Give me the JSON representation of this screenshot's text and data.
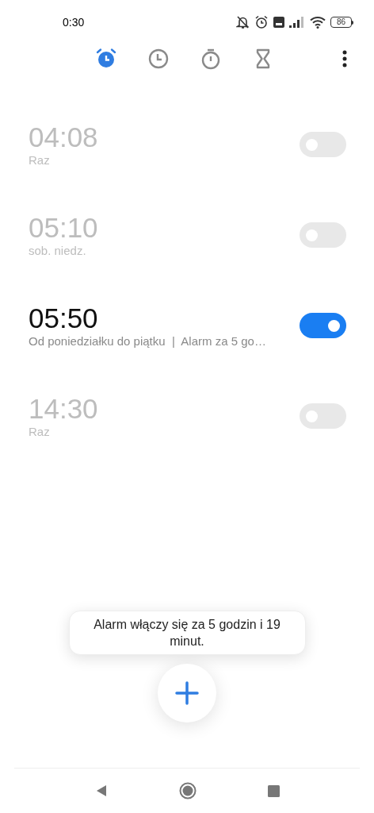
{
  "status_bar": {
    "time": "0:30",
    "battery": "86"
  },
  "tabs": [
    {
      "kind": "alarm",
      "selected": true
    },
    {
      "kind": "clock",
      "selected": false
    },
    {
      "kind": "stopwatch",
      "selected": false
    },
    {
      "kind": "timer",
      "selected": false
    }
  ],
  "alarms": [
    {
      "time": "04:08",
      "repeat": "Raz",
      "on": false
    },
    {
      "time": "05:10",
      "repeat": "sob. niedz.",
      "on": false
    },
    {
      "time": "05:50",
      "repeat": "Od poniedziałku do piątku  |  Alarm za 5 go…",
      "on": true
    },
    {
      "time": "14:30",
      "repeat": "Raz",
      "on": false
    }
  ],
  "toast": "Alarm włączy się za 5 godzin i 19 minut."
}
